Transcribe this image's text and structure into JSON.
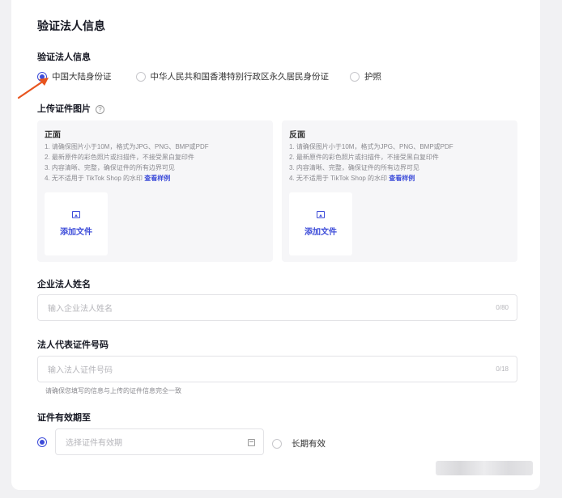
{
  "section_title": "验证法人信息",
  "id_type": {
    "label": "验证法人信息",
    "options": [
      "中国大陆身份证",
      "中华人民共和国香港特别行政区永久居民身份证",
      "护照"
    ],
    "selected_index": 0
  },
  "upload": {
    "label": "上传证件图片",
    "help_icon": "?",
    "front": {
      "side": "正面",
      "rules": [
        "1. 请确保图片小于10M，格式为JPG、PNG、BMP或PDF",
        "2. 最新原件的彩色照片或扫描件，不接受黑白复印件",
        "3. 内容清晰、完整，确保证件的所有边界可见",
        "4. 无不适用于 TikTok Shop 的水印"
      ],
      "example_link": "查看样例",
      "add_file": "添加文件"
    },
    "back": {
      "side": "反面",
      "rules": [
        "1. 请确保图片小于10M，格式为JPG、PNG、BMP或PDF",
        "2. 最新原件的彩色照片或扫描件，不接受黑白复印件",
        "3. 内容清晰、完整，确保证件的所有边界可见",
        "4. 无不适用于 TikTok Shop 的水印"
      ],
      "example_link": "查看样例",
      "add_file": "添加文件"
    }
  },
  "name_field": {
    "label": "企业法人姓名",
    "placeholder": "输入企业法人姓名",
    "counter": "0/80"
  },
  "id_number_field": {
    "label": "法人代表证件号码",
    "placeholder": "输入法人证件号码",
    "counter": "0/18",
    "hint": "请确保您填写的信息与上传的证件信息完全一致"
  },
  "validity": {
    "label": "证件有效期至",
    "date_placeholder": "选择证件有效期",
    "long_term": "长期有效"
  },
  "colors": {
    "accent": "#3d4cd9",
    "arrow": "#e8541e"
  }
}
